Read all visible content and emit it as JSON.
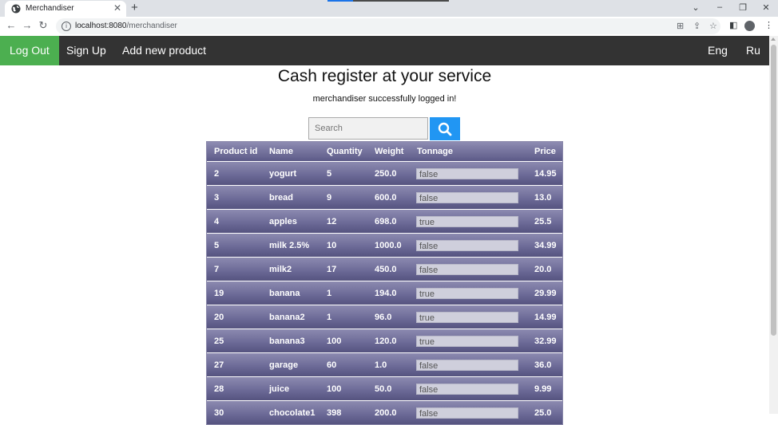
{
  "browser": {
    "tab_title": "Merchandiser",
    "new_tab_glyph": "+",
    "close_glyph": "✕",
    "url_host": "localhost:8080",
    "url_path": "/merchandiser",
    "icons": [
      "globe-icon",
      "back-icon",
      "forward-icon",
      "reload-icon",
      "info-icon",
      "translate-icon",
      "share-icon",
      "star-icon",
      "side-panel-icon",
      "profile-icon",
      "menu-icon"
    ]
  },
  "navbar": {
    "logout_label": "Log Out",
    "signup_label": "Sign Up",
    "add_product_label": "Add new product",
    "lang_en_label": "Eng",
    "lang_ru_label": "Ru",
    "colors": {
      "bar": "#333333",
      "active": "#4caf50"
    }
  },
  "main": {
    "title": "Cash register at your service",
    "status": "merchandiser successfully logged in!"
  },
  "search": {
    "placeholder": "Search",
    "button_color": "#2196f3"
  },
  "table": {
    "headers": [
      "Product id",
      "Name",
      "Quantity",
      "Weight",
      "Tonnage",
      "Price"
    ],
    "rows": [
      {
        "id": "2",
        "name": "yogurt",
        "quantity": "5",
        "weight": "250.0",
        "tonnage": "false",
        "price": "14.95"
      },
      {
        "id": "3",
        "name": "bread",
        "quantity": "9",
        "weight": "600.0",
        "tonnage": "false",
        "price": "13.0"
      },
      {
        "id": "4",
        "name": "apples",
        "quantity": "12",
        "weight": "698.0",
        "tonnage": "true",
        "price": "25.5"
      },
      {
        "id": "5",
        "name": "milk 2.5%",
        "quantity": "10",
        "weight": "1000.0",
        "tonnage": "false",
        "price": "34.99"
      },
      {
        "id": "7",
        "name": "milk2",
        "quantity": "17",
        "weight": "450.0",
        "tonnage": "false",
        "price": "20.0"
      },
      {
        "id": "19",
        "name": "banana",
        "quantity": "1",
        "weight": "194.0",
        "tonnage": "true",
        "price": "29.99"
      },
      {
        "id": "20",
        "name": "banana2",
        "quantity": "1",
        "weight": "96.0",
        "tonnage": "true",
        "price": "14.99"
      },
      {
        "id": "25",
        "name": "banana3",
        "quantity": "100",
        "weight": "120.0",
        "tonnage": "true",
        "price": "32.99"
      },
      {
        "id": "27",
        "name": "garage",
        "quantity": "60",
        "weight": "1.0",
        "tonnage": "false",
        "price": "36.0"
      },
      {
        "id": "28",
        "name": "juice",
        "quantity": "100",
        "weight": "50.0",
        "tonnage": "false",
        "price": "9.99"
      },
      {
        "id": "30",
        "name": "chocolate1",
        "quantity": "398",
        "weight": "200.0",
        "tonnage": "false",
        "price": "25.0"
      }
    ]
  }
}
